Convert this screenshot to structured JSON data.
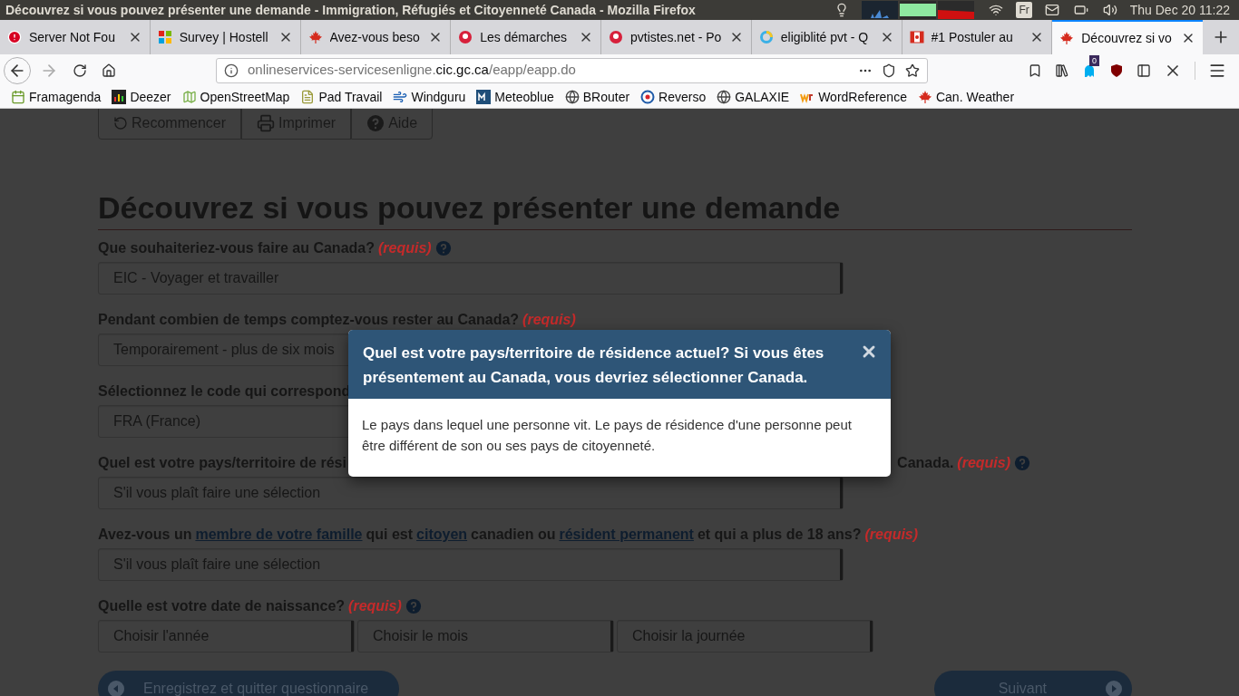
{
  "window": {
    "title": "Découvrez si vous pouvez présenter une demande - Immigration, Réfugiés et Citoyenneté Canada - Mozilla Firefox"
  },
  "system_tray": {
    "keyboard": "Fr",
    "clock": "Thu Dec 20 11:22"
  },
  "tabs": [
    {
      "label": "Server Not Fou",
      "selected": false
    },
    {
      "label": "Survey | Hostell",
      "selected": false
    },
    {
      "label": "Avez-vous beso",
      "selected": false
    },
    {
      "label": "Les démarches",
      "selected": false
    },
    {
      "label": "pvtistes.net - Po",
      "selected": false
    },
    {
      "label": "eligiblité pvt - Q",
      "selected": false
    },
    {
      "label": "#1 Postuler au",
      "selected": false
    },
    {
      "label": "Découvrez si vo",
      "selected": true
    }
  ],
  "address_bar": {
    "prefix": "onlineservices-servicesenligne.",
    "domain": "cic.gc.ca",
    "path": "/eapp/eapp.do"
  },
  "extension_badge": "0",
  "bookmarks": [
    "Framagenda",
    "Deezer",
    "OpenStreetMap",
    "Pad Travail",
    "Windguru",
    "Meteoblue",
    "BRouter",
    "Reverso",
    "GALAXIE",
    "WordReference",
    "Can. Weather"
  ],
  "page": {
    "toolbar": [
      "Recommencer",
      "Imprimer",
      "Aide"
    ],
    "heading": "Découvrez si vous pouvez présenter une demande",
    "questions": [
      {
        "label_parts": [
          {
            "kind": "plain",
            "text": "Que souhaiteriez-vous faire au Canada?"
          }
        ],
        "required": "(requis)",
        "help": true,
        "selects": [
          "EIC - Voyager et travailler"
        ]
      },
      {
        "label_parts": [
          {
            "kind": "plain",
            "text": "Pendant combien de temps comptez-vous rester au Canada?"
          }
        ],
        "required": "(requis)",
        "help": false,
        "selects": [
          "Temporairement - plus de six mois"
        ]
      },
      {
        "label_parts": [
          {
            "kind": "plain",
            "text": "Sélectionnez le code qui correspond"
          }
        ],
        "help": false,
        "selects": [
          "FRA (France)"
        ]
      },
      {
        "label_parts": [
          {
            "kind": "plain",
            "text": "Quel est votre pays/territoire de rési"
          }
        ],
        "label_tail": "Canada.",
        "required": "(requis)",
        "help": true,
        "selects": [
          "S'il vous plaît faire une sélection"
        ]
      },
      {
        "label_parts": [
          {
            "kind": "plain",
            "text": "Avez-vous un"
          },
          {
            "kind": "link",
            "text": "membre de votre famille"
          },
          {
            "kind": "plain",
            "text": "qui est"
          },
          {
            "kind": "link",
            "text": "citoyen"
          },
          {
            "kind": "plain",
            "text": "canadien ou"
          },
          {
            "kind": "link",
            "text": "résident permanent"
          },
          {
            "kind": "plain",
            "text": "et qui a plus de 18 ans?"
          }
        ],
        "required": "(requis)",
        "help": false,
        "selects": [
          "S'il vous plaît faire une sélection"
        ]
      },
      {
        "label_parts": [
          {
            "kind": "plain",
            "text": "Quelle est votre date de naissance?"
          }
        ],
        "required": "(requis)",
        "help": true,
        "selects": [
          "Choisir l'année",
          "Choisir le mois",
          "Choisir la journée"
        ]
      }
    ],
    "nav": {
      "back": "Enregistrez et quitter questionnaire",
      "next": "Suivant"
    }
  },
  "modal": {
    "title": "Quel est votre pays/territoire de résidence actuel? Si vous êtes présentement au Canada, vous devriez sélectionner Canada.",
    "body": "Le pays dans lequel une personne vit. Le pays de résidence d'une personne peut être différent de son ou ses pays de citoyenneté."
  }
}
